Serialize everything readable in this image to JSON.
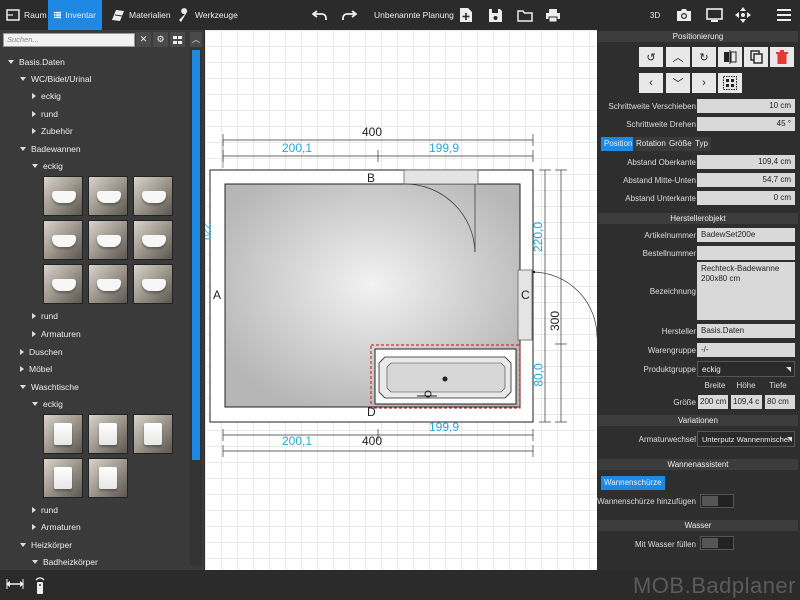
{
  "toolbar": {
    "raum": "Raum",
    "inventar": "Inventar",
    "materialien": "Materialien",
    "werkzeuge": "Werkzeuge",
    "planning_title": "Unbenannte Planung",
    "view_3d": "3D"
  },
  "sidebar": {
    "search_placeholder": "Suchen...",
    "root": "Basis.Daten",
    "items": {
      "wc": "WC/Bidet/Urinal",
      "wc_eckig": "eckig",
      "wc_rund": "rund",
      "wc_zubehoer": "Zubehör",
      "badewannen": "Badewannen",
      "bw_eckig": "eckig",
      "bw_rund": "rund",
      "bw_armaturen": "Armaturen",
      "duschen": "Duschen",
      "moebel": "Möbel",
      "waschtische": "Waschtische",
      "wt_eckig": "eckig",
      "wt_rund": "rund",
      "wt_armaturen": "Armaturen",
      "heizkoerper": "Heizkörper",
      "badheizkoerper": "Badheizkörper"
    }
  },
  "canvas": {
    "dim_top_total": "400",
    "dim_top_left": "200,1",
    "dim_top_right": "199,9",
    "dim_bottom_left": "200,1",
    "dim_bottom_total": "400",
    "dim_bottom_right": "199,9",
    "dim_right_upper": "220,0",
    "dim_right_total": "300",
    "dim_right_lower": "80,0",
    "dim_left_partial": "220",
    "wall_a": "A",
    "wall_b": "B",
    "wall_c": "C",
    "wall_d": "D"
  },
  "panel": {
    "positionierung": "Positionierung",
    "schrittweite_verschieben_label": "Schrittweite Verschieben",
    "schrittweite_verschieben_value": "10 cm",
    "schrittweite_drehen_label": "Schrittweite Drehen",
    "schrittweite_drehen_value": "45 °",
    "tabs": [
      "Position",
      "Rotation",
      "Größe",
      "Typ"
    ],
    "abstand_oberkante_label": "Abstand Oberkante",
    "abstand_oberkante_value": "109,4 cm",
    "abstand_mitte_label": "Abstand Mitte-Unten",
    "abstand_mitte_value": "54,7 cm",
    "abstand_unterkante_label": "Abstand Unterkante",
    "abstand_unterkante_value": "0 cm",
    "herstellerobjekt": "Herstellerobjekt",
    "artikelnummer_label": "Artikelnummer",
    "artikelnummer_value": "BadewSet200e",
    "bestellnummer_label": "Bestellnummer",
    "bestellnummer_value": "",
    "bezeichnung_label": "Bezeichnung",
    "bezeichnung_line1": "Rechteck-Badewanne",
    "bezeichnung_line2": "200x80 cm",
    "hersteller_label": "Hersteller",
    "hersteller_value": "Basis.Daten",
    "warengruppe_label": "Warengruppe",
    "warengruppe_value": "-/-",
    "produktgruppe_label": "Produktgruppe",
    "produktgruppe_value": "eckig",
    "breite_label": "Breite",
    "hoehe_label": "Höhe",
    "tiefe_label": "Tiefe",
    "groesse_label": "Größe",
    "breite_value": "200 cm",
    "hoehe_value": "109,4 c",
    "tiefe_value": "80 cm",
    "variationen": "Variationen",
    "armaturwechsel_label": "Armaturwechsel",
    "armaturwechsel_value": "Unterputz Wannenmischer",
    "wannenassistent": "Wannenassistent",
    "wannenschuerze_tab": "Wannenschürze",
    "wannenschuerze_hinzufuegen": "Wannenschürze hinzufügen",
    "wasser": "Wasser",
    "mit_wasser_fuellen": "Mit Wasser füllen"
  },
  "brand": "MOB.Badplaner",
  "colors": {
    "accent": "#1e88e5",
    "dimension_blue": "#2aa6d8",
    "delete_red": "#e53935"
  }
}
